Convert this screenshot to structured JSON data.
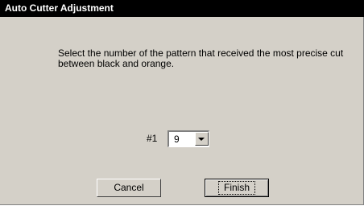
{
  "window": {
    "title": "Auto Cutter Adjustment"
  },
  "dialog": {
    "instruction": "Select the number of the pattern that received the most precise cut between black and orange.",
    "pattern_label": "#1",
    "pattern_value": "9"
  },
  "buttons": {
    "cancel_label": "Cancel",
    "finish_label": "Finish"
  },
  "icons": {
    "dropdown": "chevron-down-icon"
  },
  "colors": {
    "titlebar": "#000000",
    "face": "#d4d0c8"
  }
}
